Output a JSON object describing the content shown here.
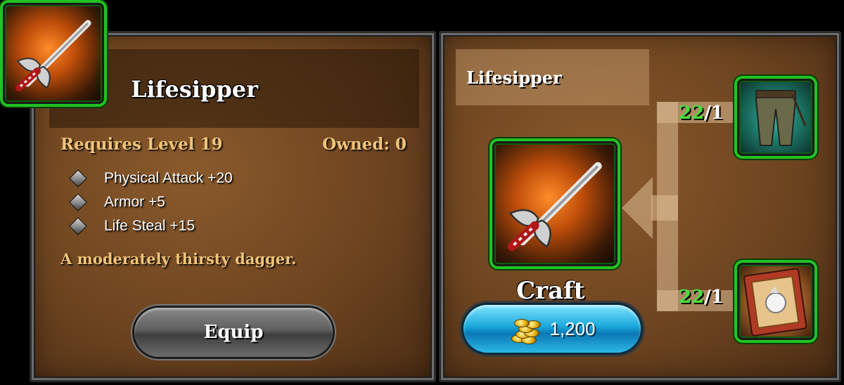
{
  "item": {
    "name": "Lifesipper",
    "requires_level": "Requires Level 19",
    "owned": "Owned: 0",
    "stats": [
      {
        "label": "Physical Attack +20"
      },
      {
        "label": "Armor +5"
      },
      {
        "label": "Life Steal +15"
      }
    ],
    "description": "A moderately thirsty dagger."
  },
  "equip_button": {
    "label": "Equip"
  },
  "recipe": {
    "name": "Lifesipper",
    "craft_label": "Craft",
    "cost": "1,200",
    "ingredients": [
      {
        "icon": "pants-icon",
        "have": "22",
        "need": "/1"
      },
      {
        "icon": "book-icon",
        "have": "22",
        "need": "/1"
      }
    ]
  },
  "colors": {
    "frame_green": "#21c321",
    "count_green": "#45e03e",
    "text_gold": "#f0c479",
    "craft_blue": "#1aa8dc"
  },
  "icons": [
    "dagger-icon",
    "pants-icon",
    "book-icon",
    "gold-coins-icon",
    "diamond-bullet-icon"
  ]
}
